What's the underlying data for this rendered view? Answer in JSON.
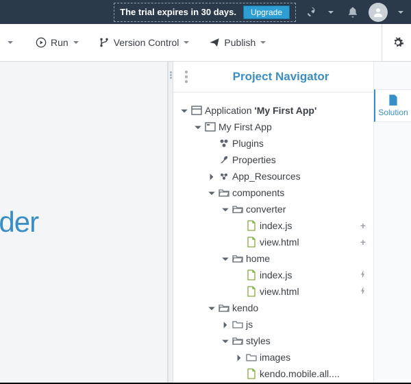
{
  "topbar": {
    "trial_text": "The trial expires in 30 days.",
    "upgrade_label": "Upgrade"
  },
  "toolbar": {
    "run_label": "Run",
    "vcs_label": "Version Control",
    "publish_label": "Publish"
  },
  "brand": "pBuilder",
  "navigator": {
    "title": "Project Navigator"
  },
  "right_tab": {
    "solution": "Solution"
  },
  "tree": {
    "app_prefix": "Application ",
    "app_name": "'My First App'",
    "root_project": "My First App",
    "plugins": "Plugins",
    "properties": "Properties",
    "app_resources": "App_Resources",
    "components": "components",
    "converter": "converter",
    "home": "home",
    "index_js": "index.js",
    "view_html": "view.html",
    "kendo": "kendo",
    "js": "js",
    "styles": "styles",
    "images": "images",
    "kendo_mobile_css": "kendo.mobile.all...."
  }
}
